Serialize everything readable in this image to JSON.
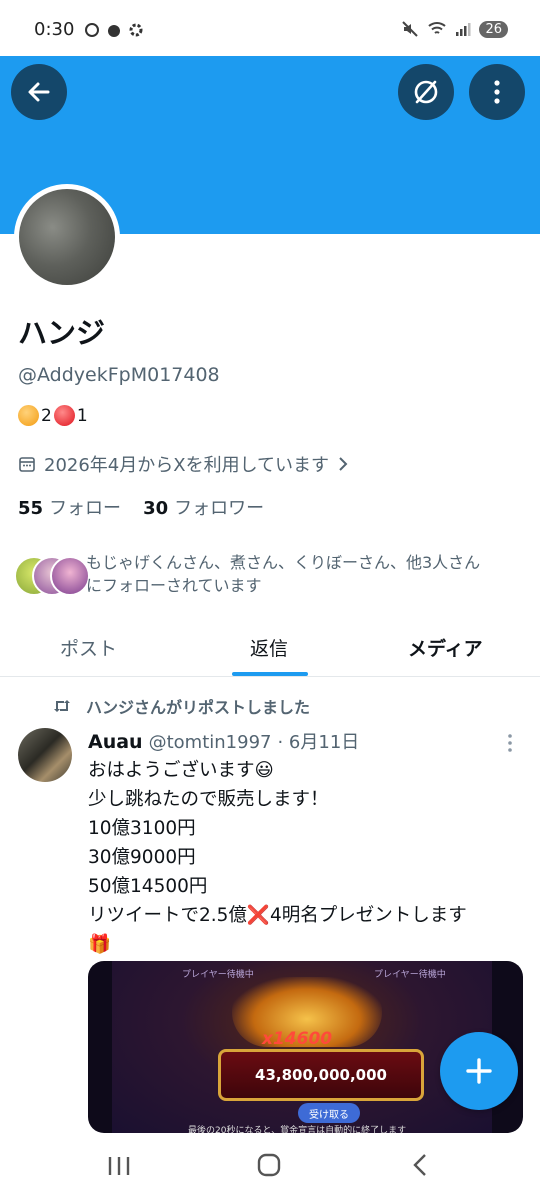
{
  "status_bar": {
    "time": "0:30",
    "battery": "26"
  },
  "profile": {
    "name": "ハンジ",
    "handle": "@AddyekFpM017408",
    "badge_count_1": "2",
    "badge_count_2": "1",
    "joined": "2026年4月からXを利用しています",
    "following_count": "55",
    "following_label": "フォロー",
    "followers_count": "30",
    "followers_label": "フォロワー",
    "followed_by_line1": "もじゃげくんさん、煮さん、くりぼーさん、他3人さん",
    "followed_by_line2": "にフォローされています"
  },
  "tabs": [
    {
      "label": "ポスト"
    },
    {
      "label": "返信"
    },
    {
      "label": "メディア"
    }
  ],
  "active_tab": "返信",
  "tweet": {
    "repost_label": "ハンジさんがリポストしました",
    "display_name": "Auau",
    "handle": "@tomtin1997",
    "date": "· 6月11日",
    "lines": [
      "おはようございます😃",
      "少し跳ねたので販売します！",
      "10億3100円",
      "30億9000円",
      "50億14500円",
      "リツイートで2.5億❌4明名プレゼントします",
      "🎁"
    ],
    "media": {
      "multiplier": "x14600",
      "amount": "43,800,000,000",
      "button": "受け取る",
      "caption": "最後の20秒になると、賞金宣言は自動的に終了します",
      "top_left": "プレイヤー待機中",
      "top_right": "プレイヤー待機中"
    }
  },
  "colors": {
    "accent": "#1d9bf0",
    "text": "#0f1419",
    "muted": "#536471"
  },
  "icons": [
    "back-arrow-icon",
    "no-notifications-icon",
    "more-vertical-icon",
    "calendar-icon",
    "chevron-right-icon",
    "repost-icon",
    "plus-icon"
  ]
}
